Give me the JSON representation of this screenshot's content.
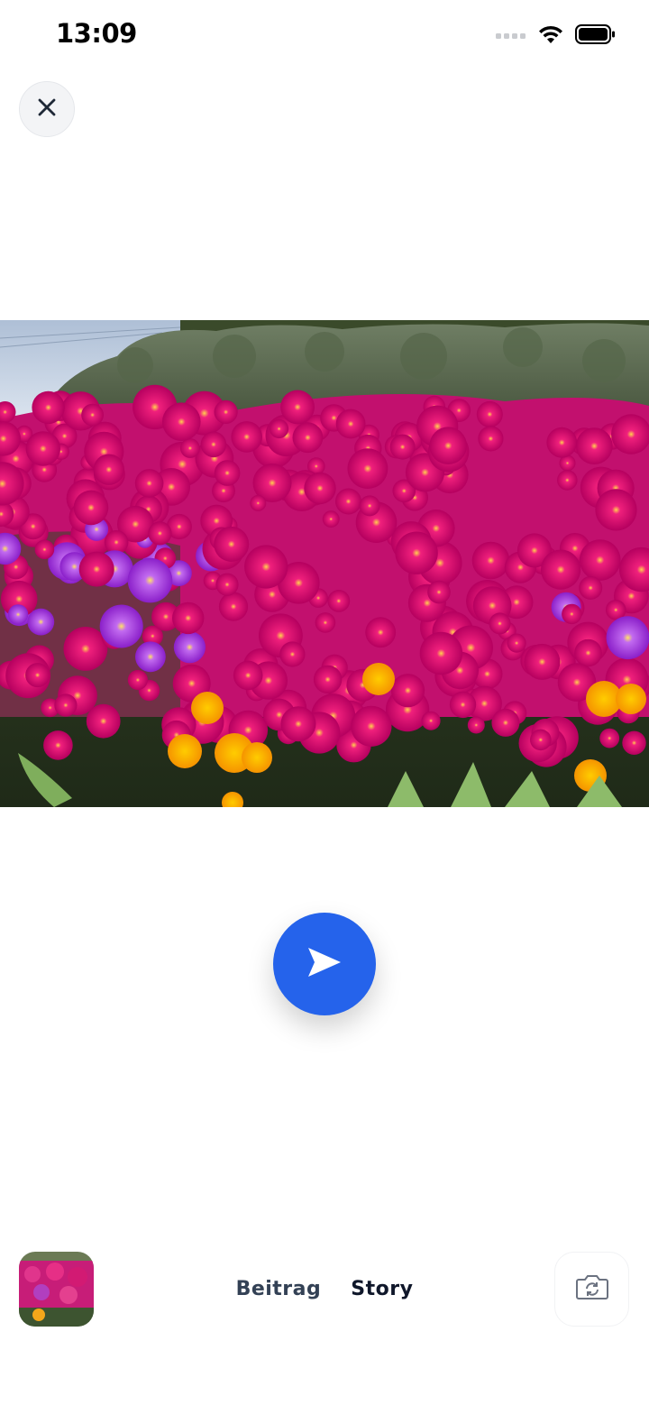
{
  "status_bar": {
    "time": "13:09",
    "icons": [
      "signal-icon",
      "wifi-icon",
      "battery-icon"
    ]
  },
  "header": {
    "close_icon": "close-icon"
  },
  "preview": {
    "image_subject": "field of magenta, purple and yellow ice plant flowers with green shrubs"
  },
  "actions": {
    "send_icon": "send-icon"
  },
  "bottom_bar": {
    "tabs": [
      {
        "label": "Beitrag",
        "active": false
      },
      {
        "label": "Story",
        "active": true
      }
    ],
    "flip_camera_icon": "camera-flip-icon"
  },
  "colors": {
    "accent": "#2563eb",
    "tab_active": "#0f172a",
    "tab_inactive": "#334155",
    "close_bg": "#f3f4f6"
  }
}
